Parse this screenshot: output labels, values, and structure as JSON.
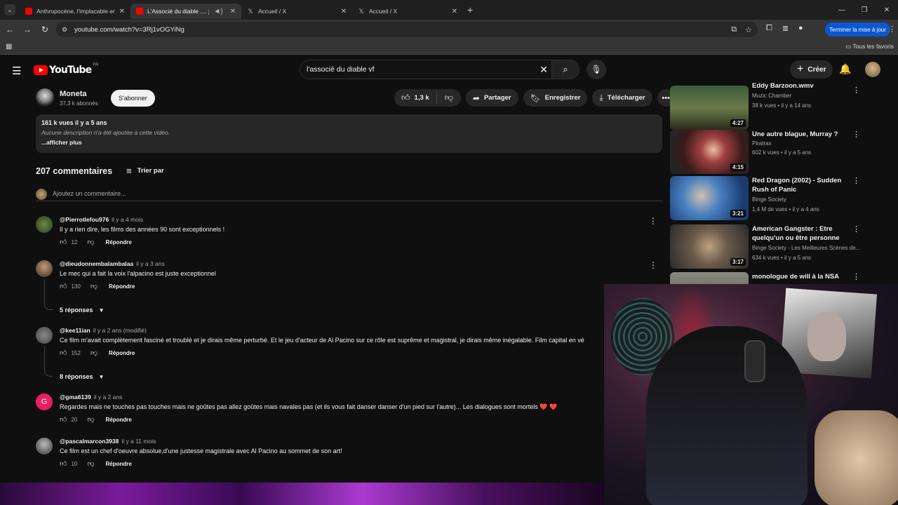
{
  "browser": {
    "tabs": [
      {
        "title": "Anthropocène, l'implacable en...",
        "favicon": "youtube-icon"
      },
      {
        "title": "L'Associé du diable .... j'aim...",
        "favicon": "youtube-icon",
        "active": true
      },
      {
        "title": "Accueil / X",
        "favicon": "x-icon"
      },
      {
        "title": "Accueil / X",
        "favicon": "x-icon"
      }
    ],
    "url": "youtube.com/watch?v=3Rj1vOGYiNg",
    "update_button": "Terminer la mise à jour",
    "bookmarks_all": "Tous les favoris"
  },
  "youtube": {
    "logo_text": "YouTube",
    "logo_country": "FR",
    "search_query": "l'associé du diable vf",
    "create_label": "Créer"
  },
  "video": {
    "channel_name": "Moneta",
    "subscribers": "37,3 k abonnés",
    "subscribe_label": "S'abonner",
    "likes": "1,3 k",
    "share_label": "Partager",
    "save_label": "Enregistrer",
    "download_label": "Télécharger",
    "views_date": "161 k vues  il y a 5 ans",
    "description": "Aucune description n'a été ajoutée à cette vidéo.",
    "show_more": "...afficher plus"
  },
  "comments": {
    "count_label": "207 commentaires",
    "sort_label": "Trier par",
    "add_placeholder": "Ajoutez un commentaire...",
    "reply_label": "Répondre",
    "items": [
      {
        "author": "@Pierrotlefou976",
        "time": "il y a 4 mois",
        "text": "Il y a rien dire, les films des années 90 sont exceptionnels !",
        "likes": "12"
      },
      {
        "author": "@dieudonnembalambalaa",
        "time": "il y a 3 ans",
        "text": "Le mec qui a fait la voix l'alpacino est juste exceptionnel",
        "likes": "130",
        "replies": "5 réponses"
      },
      {
        "author": "@kee11ian",
        "time": "il y a 2 ans (modifié)",
        "text": "Ce film m'avait complètement fasciné et troublé et je dirais même perturbé. Et le jeu d'acteur de Al Pacino sur ce rôle est suprême et magistral, je dirais même inégalable. Film capital en vé",
        "likes": "152",
        "replies": "8 réponses"
      },
      {
        "author": "@gma6139",
        "time": "il y a 2 ans",
        "text": "Regardes mais ne touches pas touches mais ne goûtes pas allez goûtes mais navales pas (et ils vous fait danser danser d'un pied sur l'autre)... Les dialogues sont mortels ❤️ ❤️",
        "likes": "20",
        "initial": "G"
      },
      {
        "author": "@pascalmarcon3938",
        "time": "il y a 11 mois",
        "text": "Ce film est un chef d'oeuvre absolue,d'une justesse magistrale avec Al Pacino au sommet de son art!",
        "likes": "10"
      }
    ]
  },
  "recommendations": [
    {
      "title": "Eddy Barzoon.wmv",
      "channel": "Muzic Chamber",
      "meta": "38 k vues • il y a 14 ans",
      "duration": "4:27"
    },
    {
      "title": "Une autre blague, Murray ?",
      "channel": "Piratrax",
      "meta": "602 k vues • il y a 5 ans",
      "duration": "4:15"
    },
    {
      "title": "Red Dragon (2002) - Sudden Rush of Panic",
      "channel": "Binge Society",
      "meta": "1,4 M de vues • il y a 4 ans",
      "duration": "3:21"
    },
    {
      "title": "American Gangster : Etre quelqu'un ou être personne",
      "channel": "Binge Society - Les Meilleures Scènes de...",
      "meta": "634 k vues • il y a 5 ans",
      "duration": "3:17"
    },
    {
      "title": "monologue de will à la NSA",
      "channel": "",
      "meta": "",
      "duration": ""
    }
  ],
  "colors": {
    "youtube_red": "#ff0000",
    "bg": "#0f0f0f",
    "update_blue": "#0b57d0"
  }
}
